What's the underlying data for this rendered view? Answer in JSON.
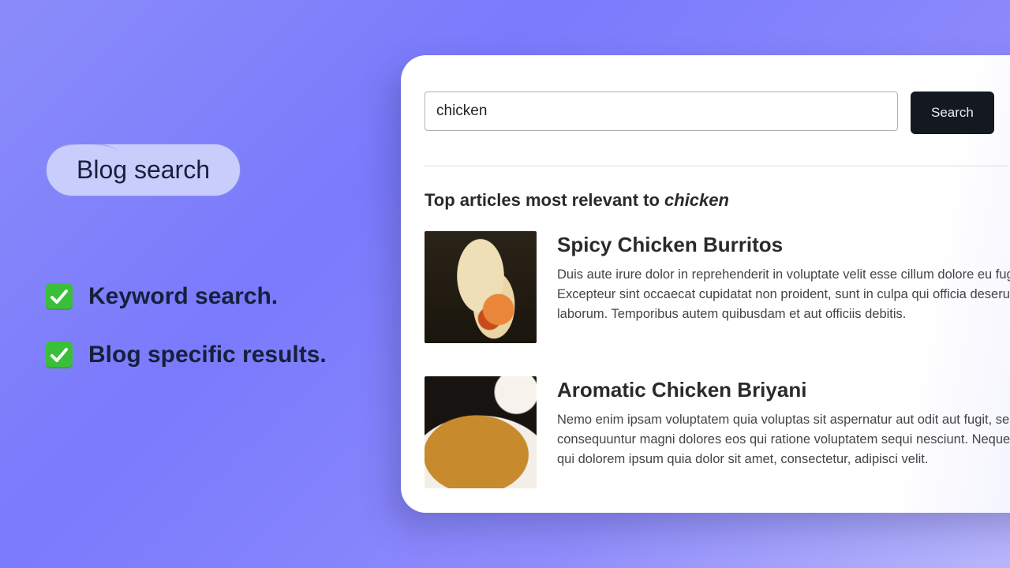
{
  "badge": {
    "label": "Blog search"
  },
  "bullets": [
    {
      "text": "Keyword search."
    },
    {
      "text": "Blog specific results."
    }
  ],
  "search": {
    "value": "chicken",
    "button_label": "Search"
  },
  "results_heading": {
    "prefix": "Top articles most relevant to ",
    "query": "chicken"
  },
  "results": [
    {
      "title": "Spicy Chicken Burritos",
      "desc": "Duis aute irure dolor in reprehenderit in voluptate velit esse cillum dolore eu fugiat. Excepteur sint occaecat cupidatat non proident, sunt in culpa qui officia deserunt est laborum. Temporibus autem quibusdam et aut officiis debitis.",
      "thumb_class": "burrito"
    },
    {
      "title": "Aromatic Chicken Briyani",
      "desc": "Nemo enim ipsam voluptatem quia voluptas sit aspernatur aut odit aut fugit, sed qu consequuntur magni dolores eos qui ratione voluptatem sequi nesciunt. Neque por est, qui dolorem ipsum quia dolor sit amet, consectetur, adipisci velit.",
      "thumb_class": "briyani"
    }
  ]
}
